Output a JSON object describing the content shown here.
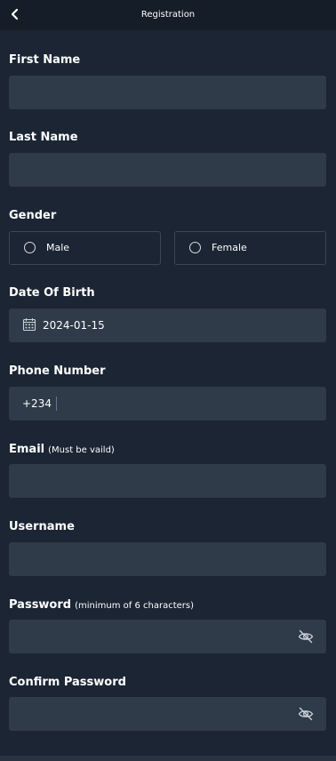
{
  "header": {
    "title": "Registration",
    "back_icon": "chevron-left-icon"
  },
  "form": {
    "first_name": {
      "label": "First Name",
      "value": ""
    },
    "last_name": {
      "label": "Last Name",
      "value": ""
    },
    "gender": {
      "label": "Gender",
      "options": [
        "Male",
        "Female"
      ],
      "selected": null
    },
    "dob": {
      "label": "Date Of Birth",
      "value": "2024-01-15",
      "icon": "calendar-icon"
    },
    "phone": {
      "label": "Phone Number",
      "prefix": "+234",
      "value": ""
    },
    "email": {
      "label": "Email",
      "hint": "(Must be vaild)",
      "value": ""
    },
    "username": {
      "label": "Username",
      "value": ""
    },
    "password": {
      "label": "Password",
      "hint": "(minimum of 6 characters)",
      "value": "",
      "icon": "eye-off-icon"
    },
    "confirm_password": {
      "label": "Confirm Password",
      "value": "",
      "icon": "eye-off-icon"
    }
  },
  "colors": {
    "background": "#1b2533",
    "header": "#151d28",
    "field": "#2f3b48",
    "text": "#ffffff"
  }
}
